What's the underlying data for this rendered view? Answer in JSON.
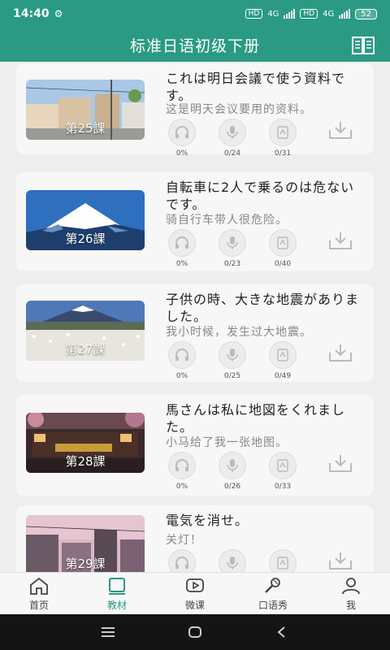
{
  "status_bar": {
    "time": "14:40",
    "indicators": [
      "HD",
      "4G",
      "HD",
      "4G"
    ],
    "battery": "52"
  },
  "header": {
    "title": "标准日语初级下册",
    "icon": "book-icon"
  },
  "lessons": [
    {
      "label": "第25課",
      "japanese": "これは明日会議で使う資料です。",
      "chinese": "这是明天会议要用的资料。",
      "listen": "0%",
      "speak": "0/24",
      "write": "0/31",
      "image": "street-scene"
    },
    {
      "label": "第26課",
      "japanese": "自転車に2人で乗るのは危ないです。",
      "chinese": "骑自行车带人很危险。",
      "listen": "0%",
      "speak": "0/23",
      "write": "0/40",
      "image": "mount-fuji"
    },
    {
      "label": "第27課",
      "japanese": "子供の時、大きな地震がありました。",
      "chinese": "我小时候，发生过大地震。",
      "listen": "0%",
      "speak": "0/25",
      "write": "0/49",
      "image": "fuji-flower-field"
    },
    {
      "label": "第28課",
      "japanese": "馬さんは私に地図をくれました。",
      "chinese": "小马给了我一张地图。",
      "listen": "0%",
      "speak": "0/26",
      "write": "0/33",
      "image": "storefront-night"
    },
    {
      "label": "第29課",
      "japanese": "電気を消せ。",
      "chinese": "关灯！",
      "listen": "",
      "speak": "",
      "write": "",
      "image": "city-dusk"
    }
  ],
  "tabs": [
    {
      "label": "首页",
      "icon": "home-icon",
      "active": false
    },
    {
      "label": "教材",
      "icon": "textbook-icon",
      "active": true
    },
    {
      "label": "微课",
      "icon": "video-icon",
      "active": false
    },
    {
      "label": "口语秀",
      "icon": "microphone-icon",
      "active": false
    },
    {
      "label": "我",
      "icon": "person-icon",
      "active": false
    }
  ],
  "colors": {
    "primary": "#2a9a84",
    "background": "#eeeeee",
    "card": "#f7f7f7",
    "nav_bar": "#141414"
  }
}
